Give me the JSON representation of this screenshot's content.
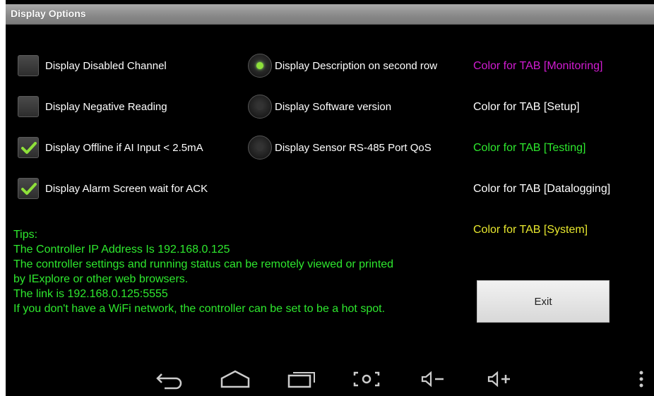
{
  "window": {
    "title": "Display Options"
  },
  "checkboxes": [
    {
      "label": "Display Disabled Channel",
      "checked": false
    },
    {
      "label": "Display Negative Reading",
      "checked": false
    },
    {
      "label": "Display Offline if AI Input < 2.5mA",
      "checked": true
    },
    {
      "label": "Display Alarm Screen wait for ACK",
      "checked": true
    }
  ],
  "radios": [
    {
      "label": "Display Description on second row",
      "selected": true
    },
    {
      "label": "Display Software version",
      "selected": false
    },
    {
      "label": "Display Sensor RS-485 Port QoS",
      "selected": false
    }
  ],
  "tab_colors": [
    {
      "label": "Color for TAB [Monitoring]",
      "color": "#d21bd2"
    },
    {
      "label": "Color for TAB [Setup]",
      "color": "#ffffff"
    },
    {
      "label": "Color for TAB [Testing]",
      "color": "#2ee82e"
    },
    {
      "label": "Color for TAB [Datalogging]",
      "color": "#ffffff"
    },
    {
      "label": "Color for TAB [System]",
      "color": "#e8e82e"
    }
  ],
  "tips": {
    "heading": "Tips:",
    "lines": [
      "The Controller IP Address Is 192.168.0.125",
      "The controller settings and running status can be remotely viewed or printed",
      "by IExplore or other web browsers.",
      "The link is 192.168.0.125:5555",
      "If you don't have a WiFi network, the controller can be set to be a hot spot."
    ]
  },
  "exit_button": {
    "label": "Exit"
  },
  "nav_bar": {
    "icons": [
      "back-icon",
      "home-icon",
      "recent-apps-icon",
      "screenshot-icon",
      "volume-down-icon",
      "volume-up-icon",
      "overflow-menu-icon"
    ]
  }
}
